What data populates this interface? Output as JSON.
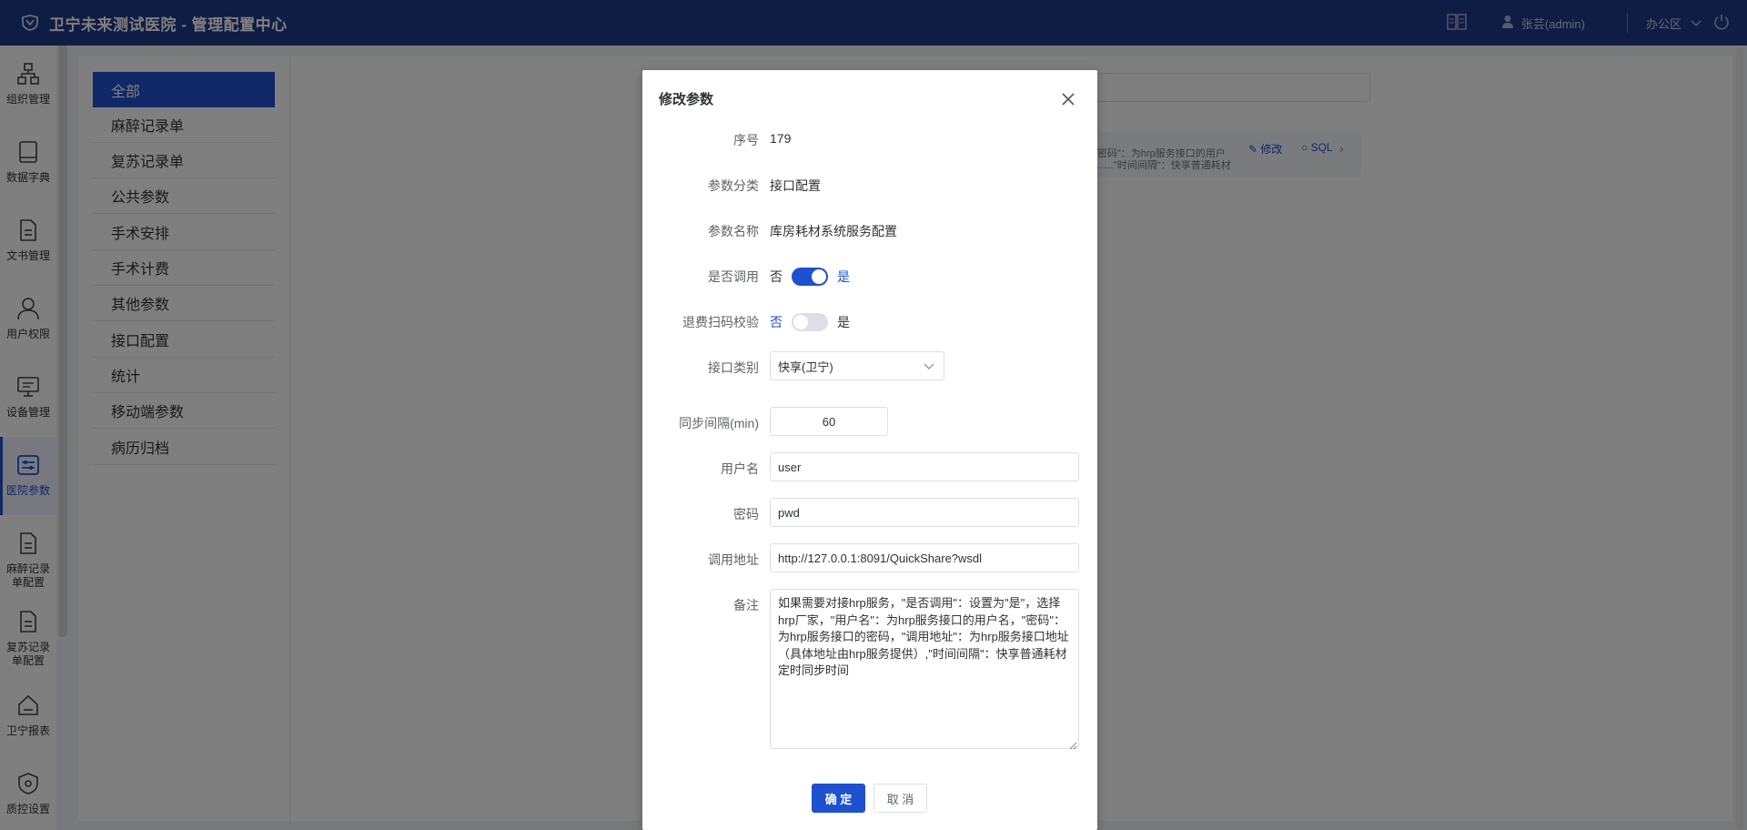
{
  "header": {
    "title": "卫宁未来测试医院 - 管理配置中心",
    "user": "张芸(admin)",
    "office": "办公区"
  },
  "nav": {
    "items": [
      {
        "label": "组织管理",
        "icon": "org-icon"
      },
      {
        "label": "数据字典",
        "icon": "book-icon"
      },
      {
        "label": "文书管理",
        "icon": "document-icon"
      },
      {
        "label": "用户权限",
        "icon": "user-icon"
      },
      {
        "label": "设备管理",
        "icon": "monitor-icon"
      },
      {
        "label": "医院参数",
        "icon": "sliders-icon"
      },
      {
        "label": "麻醉记录单配置",
        "icon": "document-icon"
      },
      {
        "label": "复苏记录单配置",
        "icon": "document-icon"
      },
      {
        "label": "卫宁报表",
        "icon": "home-icon"
      },
      {
        "label": "质控设置",
        "icon": "shield-icon"
      }
    ],
    "active_index": 5
  },
  "categories": {
    "items": [
      "全部",
      "麻醉记录单",
      "复苏记录单",
      "公共参数",
      "手术安排",
      "手术计费",
      "其他参数",
      "接口配置",
      "统计",
      "移动端参数",
      "病历归档"
    ],
    "active_index": 0
  },
  "background_card": {
    "desc": "用户名、\"密码\"：为hrp服务接口的用户名、密码……\"时间间隔\"：快享普通耗材定时同步时间",
    "edit": "修改",
    "sql": "SQL"
  },
  "dialog": {
    "title": "修改参数",
    "labels": {
      "seq": "序号",
      "category": "参数分类",
      "name": "参数名称",
      "enabled": "是否调用",
      "refund_scan": "退费扫码校验",
      "iface_type": "接口类别",
      "sync_interval": "同步间隔(min)",
      "username": "用户名",
      "password": "密码",
      "url": "调用地址",
      "remark": "备注"
    },
    "values": {
      "seq": "179",
      "category": "接口配置",
      "name": "库房耗材系统服务配置",
      "iface_type": "快享(卫宁)",
      "sync_interval": "60",
      "username": "user",
      "password": "pwd",
      "url": "http://127.0.0.1:8091/QuickShare?wsdl",
      "remark": "如果需要对接hrp服务，\"是否调用\"：设置为\"是\"，选择hrp厂家，\"用户名\"：为hrp服务接口的用户名，\"密码\"：为hrp服务接口的密码，\"调用地址\"：为hrp服务接口地址（具体地址由hrp服务提供）,\"时间间隔\"：快享普通耗材定时同步时间"
    },
    "switch_no": "否",
    "switch_yes": "是",
    "enabled_on": true,
    "refund_scan_on": false,
    "confirm": "确 定",
    "cancel": "取 消"
  },
  "colors": {
    "header": "#1e3a8a",
    "primary": "#1e50d0"
  }
}
